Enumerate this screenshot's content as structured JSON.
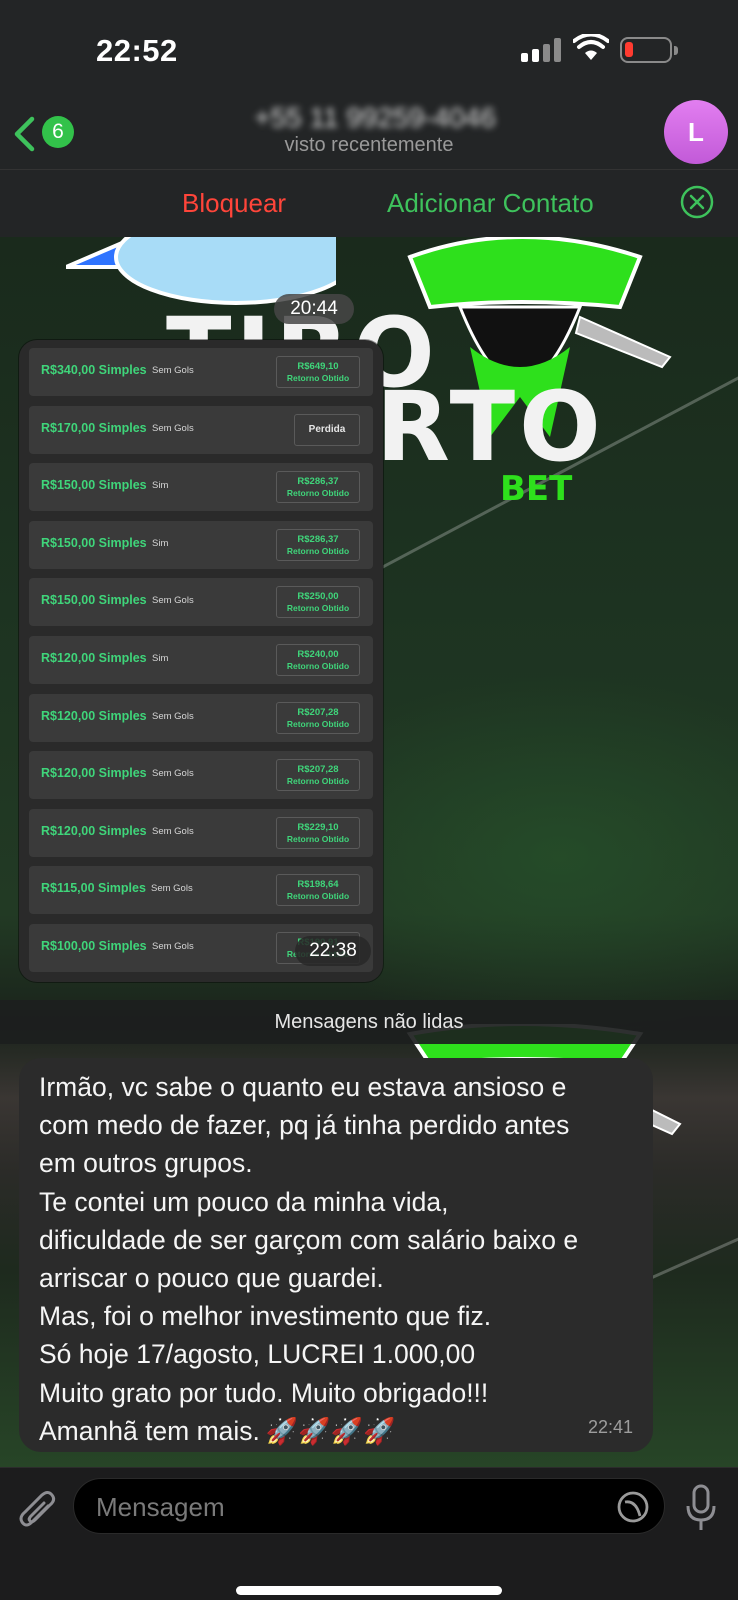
{
  "status_bar": {
    "time": "22:52"
  },
  "header": {
    "back_badge": "6",
    "contact_name": "+55 11 99259-4046",
    "contact_status": "visto recentemente",
    "avatar_initial": "L"
  },
  "action_bar": {
    "block_label": "Bloquear",
    "add_contact_label": "Adicionar Contato"
  },
  "wallpaper": {
    "logo_word_top": "TIRO",
    "logo_word_bottom": "RTO",
    "logo_bet": "BET"
  },
  "chat": {
    "date_pill": "20:44",
    "image_message": {
      "time": "22:38",
      "bets": [
        {
          "amount": "R$340,00 Simples",
          "market": "Sem Gols",
          "result_value": "R$649,10",
          "result_label": "Retorno Obtido"
        },
        {
          "amount": "R$170,00 Simples",
          "market": "Sem Gols",
          "result_value": "Perdida",
          "result_label": ""
        },
        {
          "amount": "R$150,00 Simples",
          "market": "Sim",
          "result_value": "R$286,37",
          "result_label": "Retorno Obtido"
        },
        {
          "amount": "R$150,00 Simples",
          "market": "Sim",
          "result_value": "R$286,37",
          "result_label": "Retorno Obtido"
        },
        {
          "amount": "R$150,00 Simples",
          "market": "Sem Gols",
          "result_value": "R$250,00",
          "result_label": "Retorno Obtido"
        },
        {
          "amount": "R$120,00 Simples",
          "market": "Sim",
          "result_value": "R$240,00",
          "result_label": "Retorno Obtido"
        },
        {
          "amount": "R$120,00 Simples",
          "market": "Sem Gols",
          "result_value": "R$207,28",
          "result_label": "Retorno Obtido"
        },
        {
          "amount": "R$120,00 Simples",
          "market": "Sem Gols",
          "result_value": "R$207,28",
          "result_label": "Retorno Obtido"
        },
        {
          "amount": "R$120,00 Simples",
          "market": "Sem Gols",
          "result_value": "R$229,10",
          "result_label": "Retorno Obtido"
        },
        {
          "amount": "R$115,00 Simples",
          "market": "Sem Gols",
          "result_value": "R$198,64",
          "result_label": "Retorno Obtido"
        },
        {
          "amount": "R$100,00 Simples",
          "market": "Sem Gols",
          "result_value": "R$190,91",
          "result_label": "Retorno Obtido"
        }
      ]
    },
    "unread_divider": "Mensagens não lidas",
    "text_message": {
      "lines": [
        "Irmão, vc sabe o quanto eu estava ansioso e",
        "com medo de fazer, pq já tinha perdido antes",
        "em outros grupos.",
        "Te contei um pouco da minha vida,",
        "dificuldade de ser garçom com salário baixo e",
        "arriscar o pouco que guardei.",
        "Mas, foi o melhor investimento que fiz.",
        "Só hoje 17/agosto, LUCREI 1.000,00",
        "Muito grato por tudo. Muito obrigado!!!",
        "Amanhã tem mais."
      ],
      "emoji": "🚀🚀🚀🚀",
      "time": "22:41"
    }
  },
  "composer": {
    "placeholder": "Mensagem"
  },
  "colors": {
    "accent_green": "#3ec25c",
    "danger_red": "#ff453a",
    "bet_green": "#3fd57a",
    "avatar": "#d06ce3"
  },
  "icons": [
    "back-chevron-icon",
    "close-circle-icon",
    "paperclip-icon",
    "sticker-icon",
    "microphone-icon",
    "signal-icon",
    "wifi-icon",
    "battery-icon"
  ]
}
